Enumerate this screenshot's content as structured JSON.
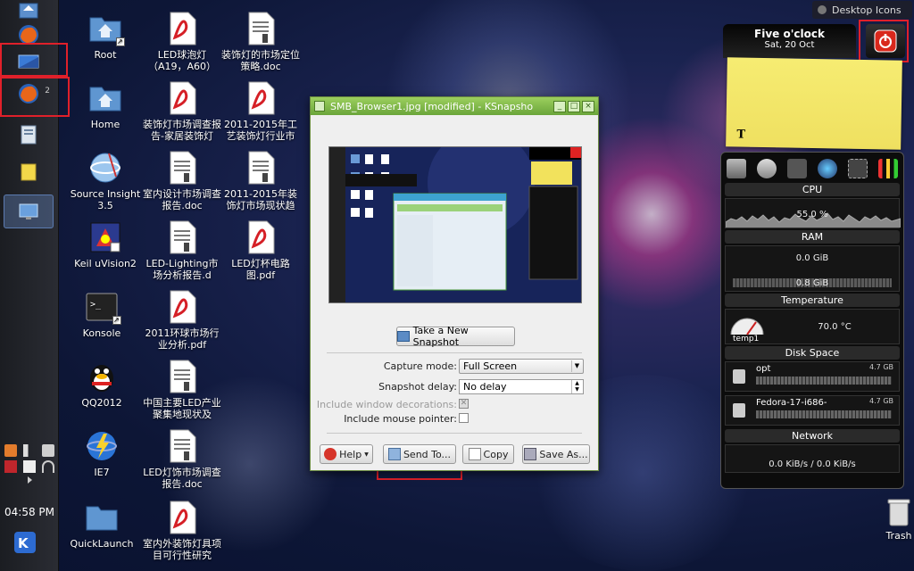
{
  "desktop": {
    "top_button": "Desktop Icons",
    "icons": [
      {
        "label": "Root",
        "icon": "folder-home-icon"
      },
      {
        "label": "Home",
        "icon": "folder-home-icon"
      },
      {
        "label": "Source Insight 3.5",
        "icon": "source-insight-icon"
      },
      {
        "label": "Keil uVision2",
        "icon": "keil-icon"
      },
      {
        "label": "Konsole",
        "icon": "terminal-icon"
      },
      {
        "label": "QQ2012",
        "icon": "qq-penguin-icon"
      },
      {
        "label": "IE7",
        "icon": "ie-globe-icon"
      },
      {
        "label": "QuickLaunch",
        "icon": "folder-icon"
      },
      {
        "label": "LED球泡灯（A19，A60）",
        "icon": "pdf-icon"
      },
      {
        "label": "装饰灯市场调查报告-家居装饰灯",
        "icon": "pdf-icon"
      },
      {
        "label": "室内设计市场调查报告.doc",
        "icon": "doc-icon"
      },
      {
        "label": "LED-Lighting市场分析报告.d",
        "icon": "doc-icon"
      },
      {
        "label": "2011环球市场行业分析.pdf",
        "icon": "pdf-icon"
      },
      {
        "label": "中国主要LED产业聚集地现状及",
        "icon": "doc-icon"
      },
      {
        "label": "LED灯饰市场调查报告.doc",
        "icon": "doc-icon"
      },
      {
        "label": "室内外装饰灯具项目可行性研究",
        "icon": "pdf-icon"
      },
      {
        "label": "装饰灯的市场定位策略.doc",
        "icon": "doc-icon"
      },
      {
        "label": "2011-2015年工艺装饰灯行业市",
        "icon": "pdf-icon"
      },
      {
        "label": "2011-2015年装饰灯市场现状趋",
        "icon": "doc-icon"
      },
      {
        "label": "LED灯杯电路图.pdf",
        "icon": "pdf-icon"
      }
    ],
    "trash_label": "Trash"
  },
  "panel": {
    "clock": "04:58 PM",
    "task_counter": "2"
  },
  "clock_widget": {
    "title": "Five o'clock",
    "date": "Sat, 20 Oct"
  },
  "note": {
    "text": "T"
  },
  "sysmon": {
    "cpu_label": "CPU",
    "cpu_value": "55.0 %",
    "ram_label": "RAM",
    "ram_value1": "0.0 GiB",
    "ram_value2": "0.8 GiB",
    "temp_label": "Temperature",
    "temp_sensor": "temp1",
    "temp_value": "70.0 °C",
    "disk_label": "Disk Space",
    "disks": [
      {
        "name": "opt",
        "size": "4.7 GB"
      },
      {
        "name": "Fedora-17-i686-",
        "size": "4.7 GB"
      }
    ],
    "network_label": "Network",
    "network_value": "0.0 KiB/s / 0.0 KiB/s"
  },
  "ksnapshot": {
    "title": "SMB_Browser1.jpg [modified] - KSnapsho",
    "new_snapshot": "Take a New Snapshot",
    "capture_mode_label": "Capture mode:",
    "capture_mode_value": "Full Screen",
    "delay_label": "Snapshot delay:",
    "delay_value": "No delay",
    "decorations_label": "Include window decorations:",
    "pointer_label": "Include mouse pointer:",
    "help": "Help",
    "send_to": "Send To...",
    "copy": "Copy",
    "save_as": "Save As..."
  }
}
